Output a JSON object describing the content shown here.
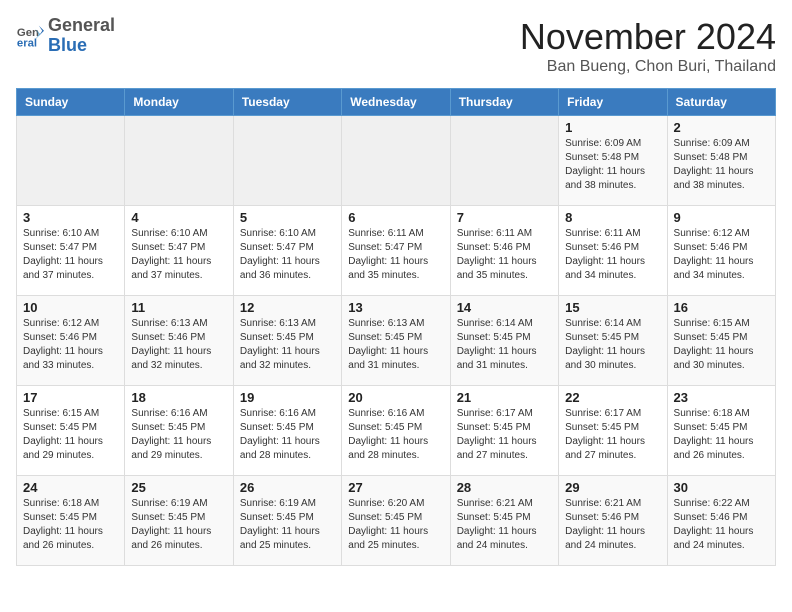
{
  "header": {
    "logo_general": "General",
    "logo_blue": "Blue",
    "month_title": "November 2024",
    "location": "Ban Bueng, Chon Buri, Thailand"
  },
  "weekdays": [
    "Sunday",
    "Monday",
    "Tuesday",
    "Wednesday",
    "Thursday",
    "Friday",
    "Saturday"
  ],
  "weeks": [
    [
      {
        "day": "",
        "info": ""
      },
      {
        "day": "",
        "info": ""
      },
      {
        "day": "",
        "info": ""
      },
      {
        "day": "",
        "info": ""
      },
      {
        "day": "",
        "info": ""
      },
      {
        "day": "1",
        "info": "Sunrise: 6:09 AM\nSunset: 5:48 PM\nDaylight: 11 hours\nand 38 minutes."
      },
      {
        "day": "2",
        "info": "Sunrise: 6:09 AM\nSunset: 5:48 PM\nDaylight: 11 hours\nand 38 minutes."
      }
    ],
    [
      {
        "day": "3",
        "info": "Sunrise: 6:10 AM\nSunset: 5:47 PM\nDaylight: 11 hours\nand 37 minutes."
      },
      {
        "day": "4",
        "info": "Sunrise: 6:10 AM\nSunset: 5:47 PM\nDaylight: 11 hours\nand 37 minutes."
      },
      {
        "day": "5",
        "info": "Sunrise: 6:10 AM\nSunset: 5:47 PM\nDaylight: 11 hours\nand 36 minutes."
      },
      {
        "day": "6",
        "info": "Sunrise: 6:11 AM\nSunset: 5:47 PM\nDaylight: 11 hours\nand 35 minutes."
      },
      {
        "day": "7",
        "info": "Sunrise: 6:11 AM\nSunset: 5:46 PM\nDaylight: 11 hours\nand 35 minutes."
      },
      {
        "day": "8",
        "info": "Sunrise: 6:11 AM\nSunset: 5:46 PM\nDaylight: 11 hours\nand 34 minutes."
      },
      {
        "day": "9",
        "info": "Sunrise: 6:12 AM\nSunset: 5:46 PM\nDaylight: 11 hours\nand 34 minutes."
      }
    ],
    [
      {
        "day": "10",
        "info": "Sunrise: 6:12 AM\nSunset: 5:46 PM\nDaylight: 11 hours\nand 33 minutes."
      },
      {
        "day": "11",
        "info": "Sunrise: 6:13 AM\nSunset: 5:46 PM\nDaylight: 11 hours\nand 32 minutes."
      },
      {
        "day": "12",
        "info": "Sunrise: 6:13 AM\nSunset: 5:45 PM\nDaylight: 11 hours\nand 32 minutes."
      },
      {
        "day": "13",
        "info": "Sunrise: 6:13 AM\nSunset: 5:45 PM\nDaylight: 11 hours\nand 31 minutes."
      },
      {
        "day": "14",
        "info": "Sunrise: 6:14 AM\nSunset: 5:45 PM\nDaylight: 11 hours\nand 31 minutes."
      },
      {
        "day": "15",
        "info": "Sunrise: 6:14 AM\nSunset: 5:45 PM\nDaylight: 11 hours\nand 30 minutes."
      },
      {
        "day": "16",
        "info": "Sunrise: 6:15 AM\nSunset: 5:45 PM\nDaylight: 11 hours\nand 30 minutes."
      }
    ],
    [
      {
        "day": "17",
        "info": "Sunrise: 6:15 AM\nSunset: 5:45 PM\nDaylight: 11 hours\nand 29 minutes."
      },
      {
        "day": "18",
        "info": "Sunrise: 6:16 AM\nSunset: 5:45 PM\nDaylight: 11 hours\nand 29 minutes."
      },
      {
        "day": "19",
        "info": "Sunrise: 6:16 AM\nSunset: 5:45 PM\nDaylight: 11 hours\nand 28 minutes."
      },
      {
        "day": "20",
        "info": "Sunrise: 6:16 AM\nSunset: 5:45 PM\nDaylight: 11 hours\nand 28 minutes."
      },
      {
        "day": "21",
        "info": "Sunrise: 6:17 AM\nSunset: 5:45 PM\nDaylight: 11 hours\nand 27 minutes."
      },
      {
        "day": "22",
        "info": "Sunrise: 6:17 AM\nSunset: 5:45 PM\nDaylight: 11 hours\nand 27 minutes."
      },
      {
        "day": "23",
        "info": "Sunrise: 6:18 AM\nSunset: 5:45 PM\nDaylight: 11 hours\nand 26 minutes."
      }
    ],
    [
      {
        "day": "24",
        "info": "Sunrise: 6:18 AM\nSunset: 5:45 PM\nDaylight: 11 hours\nand 26 minutes."
      },
      {
        "day": "25",
        "info": "Sunrise: 6:19 AM\nSunset: 5:45 PM\nDaylight: 11 hours\nand 26 minutes."
      },
      {
        "day": "26",
        "info": "Sunrise: 6:19 AM\nSunset: 5:45 PM\nDaylight: 11 hours\nand 25 minutes."
      },
      {
        "day": "27",
        "info": "Sunrise: 6:20 AM\nSunset: 5:45 PM\nDaylight: 11 hours\nand 25 minutes."
      },
      {
        "day": "28",
        "info": "Sunrise: 6:21 AM\nSunset: 5:45 PM\nDaylight: 11 hours\nand 24 minutes."
      },
      {
        "day": "29",
        "info": "Sunrise: 6:21 AM\nSunset: 5:46 PM\nDaylight: 11 hours\nand 24 minutes."
      },
      {
        "day": "30",
        "info": "Sunrise: 6:22 AM\nSunset: 5:46 PM\nDaylight: 11 hours\nand 24 minutes."
      }
    ]
  ]
}
